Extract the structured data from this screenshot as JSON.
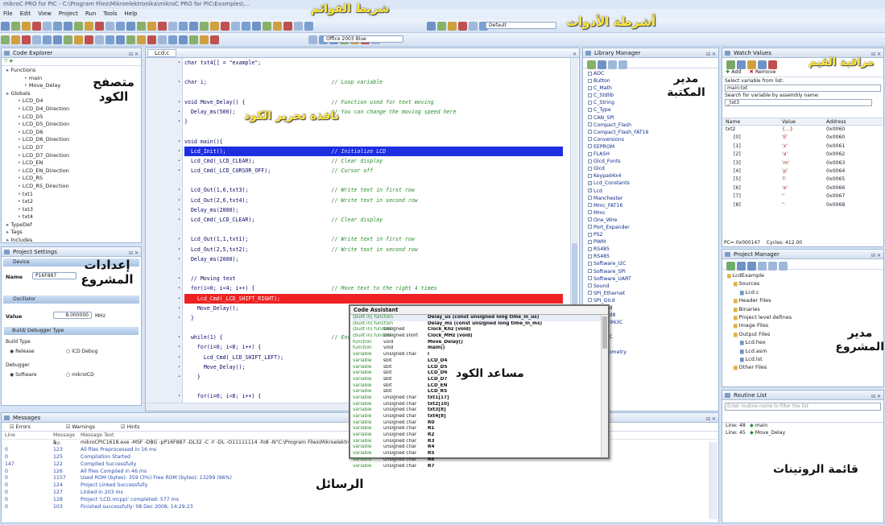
{
  "window": {
    "title": "mikroC PRO for PIC - C:\\Program Files\\Mikroelektronika\\mikroC PRO for PIC\\Examples\\..."
  },
  "menu": [
    "File",
    "Edit",
    "View",
    "Project",
    "Run",
    "Tools",
    "Help"
  ],
  "toolbar": {
    "config_select": "Default",
    "theme_select": "Office 2003 Blue"
  },
  "annotations": {
    "menu_bar": "شريط القوائم",
    "toolbars": "أشرطة الأدوات",
    "code_explorer": "متصفح\nالكود",
    "code_editor": "نافذة تحرير الكود",
    "library_manager": "مدير\nالمكتبة",
    "watch_values": "مراقبة القيم",
    "project_settings": "إعدادات\nالمشروع",
    "code_assistant": "مساعد الكود",
    "project_manager": "مدير\nالمشروع",
    "messages": "الرسائل",
    "routine_list": "قائمة الروتينات"
  },
  "code_explorer": {
    "title": "Code Explorer",
    "items": [
      "Functions",
      "main",
      "Move_Delay",
      "Globals",
      "LCD_D4",
      "LCD_D4_Direction",
      "LCD_D5",
      "LCD_D5_Direction",
      "LCD_D6",
      "LCD_D6_Direction",
      "LCD_D7",
      "LCD_D7_Direction",
      "LCD_EN",
      "LCD_EN_Direction",
      "LCD_RS",
      "LCD_RS_Direction",
      "txt1",
      "txt2",
      "txt3",
      "txt4",
      "TypeDef",
      "Tags",
      "Includes"
    ]
  },
  "project_settings": {
    "title": "Project Settings",
    "device_label": "Device",
    "name_label": "Name",
    "name_value": "P16F887",
    "osc_label": "Oscillator",
    "value_label": "Value",
    "value_value": "8.000000",
    "value_unit": "MHz",
    "build_header": "Build/ Debugger Type",
    "build_type_label": "Build Type",
    "release": "Release",
    "icd_debug": "ICD Debug",
    "debugger_label": "Debugger",
    "software": "Software",
    "mikroicd": "mikroICD"
  },
  "editor": {
    "tab": "Lcd.c",
    "lines": [
      {
        "code": "char txt4[] = \"example\";",
        "comment": "",
        "style": ""
      },
      {
        "code": "",
        "comment": "",
        "style": ""
      },
      {
        "code": "char i;",
        "comment": "// Loop variable",
        "style": ""
      },
      {
        "code": "",
        "comment": "",
        "style": ""
      },
      {
        "code": "void Move_Delay() {",
        "comment": "// Function used for text moving",
        "style": ""
      },
      {
        "code": "  Delay_ms(500);",
        "comment": "// You can change the moving speed here",
        "style": ""
      },
      {
        "code": "}",
        "comment": "",
        "style": ""
      },
      {
        "code": "",
        "comment": "",
        "style": ""
      },
      {
        "code": "void main(){",
        "comment": "",
        "style": ""
      },
      {
        "code": "  Lcd_Init();",
        "comment": "// Initialize LCD",
        "style": "blue"
      },
      {
        "code": "  Lcd_Cmd(_LCD_CLEAR);",
        "comment": "// Clear display",
        "style": ""
      },
      {
        "code": "  Lcd_Cmd(_LCD_CURSOR_OFF);",
        "comment": "// Cursor off",
        "style": ""
      },
      {
        "code": "",
        "comment": "",
        "style": ""
      },
      {
        "code": "  Lcd_Out(1,6,txt3);",
        "comment": "// Write text in first row",
        "style": ""
      },
      {
        "code": "  Lcd_Out(2,6,txt4);",
        "comment": "// Write text in second row",
        "style": ""
      },
      {
        "code": "  Delay_ms(2000);",
        "comment": "",
        "style": ""
      },
      {
        "code": "  Lcd_Cmd(_LCD_CLEAR);",
        "comment": "// Clear display",
        "style": ""
      },
      {
        "code": "",
        "comment": "",
        "style": ""
      },
      {
        "code": "  Lcd_Out(1,1,txt1);",
        "comment": "// Write text in first row",
        "style": ""
      },
      {
        "code": "  Lcd_Out(2,5,txt2);",
        "comment": "// Write text in second row",
        "style": ""
      },
      {
        "code": "  Delay_ms(2000);",
        "comment": "",
        "style": ""
      },
      {
        "code": "",
        "comment": "",
        "style": ""
      },
      {
        "code": "  // Moving text",
        "comment": "",
        "style": ""
      },
      {
        "code": "  for(i=0; i<4; i++) {",
        "comment": "// Move text to the right 4 times",
        "style": ""
      },
      {
        "code": "    Lcd_Cmd(_LCD_SHIFT_RIGHT);",
        "comment": "",
        "style": "red"
      },
      {
        "code": "    Move_Delay();",
        "comment": "",
        "style": ""
      },
      {
        "code": "  }",
        "comment": "",
        "style": ""
      },
      {
        "code": "",
        "comment": "",
        "style": ""
      },
      {
        "code": "  while(1) {",
        "comment": "// Endless loop",
        "style": ""
      },
      {
        "code": "    for(i=0; i<8; i++) {",
        "comment": "",
        "style": ""
      },
      {
        "code": "      Lcd_Cmd(_LCD_SHIFT_LEFT);",
        "comment": "",
        "style": ""
      },
      {
        "code": "      Move_Delay();",
        "comment": "",
        "style": ""
      },
      {
        "code": "    }",
        "comment": "",
        "style": ""
      },
      {
        "code": "",
        "comment": "",
        "style": ""
      },
      {
        "code": "    for(i=0; i<8; i++) {",
        "comment": "",
        "style": ""
      },
      {
        "code": "      Lcd_Cmd(_LCD_SHIFT_RIGHT);",
        "comment": "",
        "style": "red"
      },
      {
        "code": "      Move_Delay();",
        "comment": "",
        "style": ""
      },
      {
        "code": "    }",
        "comment": "",
        "style": ""
      },
      {
        "code": "",
        "comment": "",
        "style": ""
      },
      {
        "code": "  }",
        "comment": "",
        "style": ""
      },
      {
        "code": "}",
        "comment": "",
        "style": ""
      }
    ]
  },
  "code_assistant": {
    "title": "Code Assistant",
    "rows": [
      {
        "k": "(built in) function",
        "t": "",
        "n": "Delay_us (const unsigned long time_in_us)"
      },
      {
        "k": "(built in) function",
        "t": "",
        "n": "Delay_ms (const unsigned long time_in_ms)"
      },
      {
        "k": "(built in) function",
        "t": "unsigned",
        "n": "Clock_Khz (void)"
      },
      {
        "k": "(built in) function",
        "t": "unsigned short",
        "n": "Clock_MHz (void)"
      },
      {
        "k": "function",
        "t": "void",
        "n": "Move_Delay()"
      },
      {
        "k": "function",
        "t": "void",
        "n": "main()"
      },
      {
        "k": "variable",
        "t": "unsigned char",
        "n": "i"
      },
      {
        "k": "variable",
        "t": "sbit",
        "n": "LCD_D4"
      },
      {
        "k": "variable",
        "t": "sbit",
        "n": "LCD_D5"
      },
      {
        "k": "variable",
        "t": "sbit",
        "n": "LCD_D6"
      },
      {
        "k": "variable",
        "t": "sbit",
        "n": "LCD_D7"
      },
      {
        "k": "variable",
        "t": "sbit",
        "n": "LCD_EN"
      },
      {
        "k": "variable",
        "t": "sbit",
        "n": "LCD_RS"
      },
      {
        "k": "variable",
        "t": "unsigned char",
        "n": "txt1[17]"
      },
      {
        "k": "variable",
        "t": "unsigned char",
        "n": "txt2[10]"
      },
      {
        "k": "variable",
        "t": "unsigned char",
        "n": "txt3[8]"
      },
      {
        "k": "variable",
        "t": "unsigned char",
        "n": "txt4[8]"
      },
      {
        "k": "variable",
        "t": "unsigned char",
        "n": "R0"
      },
      {
        "k": "variable",
        "t": "unsigned char",
        "n": "R1"
      },
      {
        "k": "variable",
        "t": "unsigned char",
        "n": "R2"
      },
      {
        "k": "variable",
        "t": "unsigned char",
        "n": "R3"
      },
      {
        "k": "variable",
        "t": "unsigned char",
        "n": "R4"
      },
      {
        "k": "variable",
        "t": "unsigned char",
        "n": "R5"
      },
      {
        "k": "variable",
        "t": "unsigned char",
        "n": "R6"
      },
      {
        "k": "variable",
        "t": "unsigned char",
        "n": "R7"
      }
    ]
  },
  "library_manager": {
    "title": "Library Manager",
    "items": [
      "ADC",
      "Button",
      "C_Math",
      "C_Stdlib",
      "C_String",
      "C_Type",
      "CAN_SPI",
      "Compact_Flash",
      "Compact_Flash_FAT16",
      "Conversions",
      "EEPROM",
      "FLASH",
      "Glcd_Fonts",
      "Glcd",
      "Keypad4x4",
      "Lcd_Constants",
      "Lcd",
      "Manchester",
      "Mmc_FAT16",
      "Mmc",
      "One_Wire",
      "Port_Expander",
      "PS2",
      "PWM",
      "RS485",
      "RS485",
      "Software_I2C",
      "Software_SPI",
      "Software_UART",
      "Sound",
      "SPI_Ethernet",
      "SPI_Glcd",
      "SPI_Lcd",
      "SPI_Lcd8",
      "SPI_T6963C",
      "SPI",
      "T6963C",
      "Time",
      "Trigonometry",
      "UART"
    ],
    "checked": [
      15,
      16
    ]
  },
  "watch_values": {
    "title": "Watch Values",
    "add_label": "Add",
    "remove_label": "Remove",
    "select_label": "Select variable from list:",
    "select_value": "main:txt",
    "search_label": "Search for variable by assembly name:",
    "search_value": "_txt3",
    "columns": [
      "Name",
      "Value",
      "Address"
    ],
    "rows": [
      {
        "name": "txt2",
        "value": "{...}",
        "addr": "0x0060"
      },
      {
        "name": "[0]",
        "value": "'E'",
        "addr": "0x0060"
      },
      {
        "name": "[1]",
        "value": "'x'",
        "addr": "0x0061"
      },
      {
        "name": "[2]",
        "value": "'a'",
        "addr": "0x0062"
      },
      {
        "name": "[3]",
        "value": "'m'",
        "addr": "0x0063"
      },
      {
        "name": "[4]",
        "value": "'p'",
        "addr": "0x0064"
      },
      {
        "name": "[5]",
        "value": "'l'",
        "addr": "0x0065"
      },
      {
        "name": "[6]",
        "value": "'e'",
        "addr": "0x0066"
      },
      {
        "name": "[7]",
        "value": "''",
        "addr": "0x0067"
      },
      {
        "name": "[8]",
        "value": "''",
        "addr": "0x0068"
      }
    ],
    "pc": "PC= 0x000147",
    "cycles": "Cycles: 412.00"
  },
  "project_manager": {
    "title": "Project Manager",
    "items": [
      "LcdExample",
      "Sources",
      "Lcd.c",
      "Header Files",
      "Binaries",
      "Project level defines",
      "Image Files",
      "Output Files",
      "Lcd.hex",
      "Lcd.asm",
      "Lcd.lst",
      "Other Files"
    ]
  },
  "routine_list": {
    "title": "Routine List",
    "placeholder": "Enter routine name to filter the list",
    "rows": [
      {
        "line": "Line: 48",
        "name": "main"
      },
      {
        "line": "Line: 45",
        "name": "Move_Delay"
      }
    ]
  },
  "messages": {
    "title": "Messages",
    "errors": "Errors",
    "warnings": "Warnings",
    "hints": "Hints",
    "columns": [
      "Line",
      "Message No.",
      "Message Text"
    ],
    "rows": [
      {
        "line": "",
        "no": "1",
        "text": "mikroCPIC1618.exe -MSF -DBG -pP16F887 -DL32 -C -Y -DL -O11111114 -fo8 -N\"C:\\Program Files\\Mikroelektronika\\mikroC PRO for PIC\\Defs\\\" -SP\"C:\\P"
      },
      {
        "line": "0",
        "no": "123",
        "text": "All files Preprocessed in 16 ms"
      },
      {
        "line": "0",
        "no": "125",
        "text": "Compilation Started"
      },
      {
        "line": "147",
        "no": "122",
        "text": "Compiled Successfully"
      },
      {
        "line": "0",
        "no": "126",
        "text": "All files Compiled in 46 ms"
      },
      {
        "line": "0",
        "no": "1157",
        "text": "Used ROM (bytes): 359 (3%)  Free ROM (bytes): 13299 (96%)"
      },
      {
        "line": "0",
        "no": "124",
        "text": "Project Linked Successfully"
      },
      {
        "line": "0",
        "no": "127",
        "text": "Linked in 203 ms"
      },
      {
        "line": "0",
        "no": "128",
        "text": "Project 'LCD.mcppi' completed: 577 ms"
      },
      {
        "line": "0",
        "no": "103",
        "text": "Finished successfully: 08 Dec 2008, 14:29:23"
      }
    ]
  }
}
